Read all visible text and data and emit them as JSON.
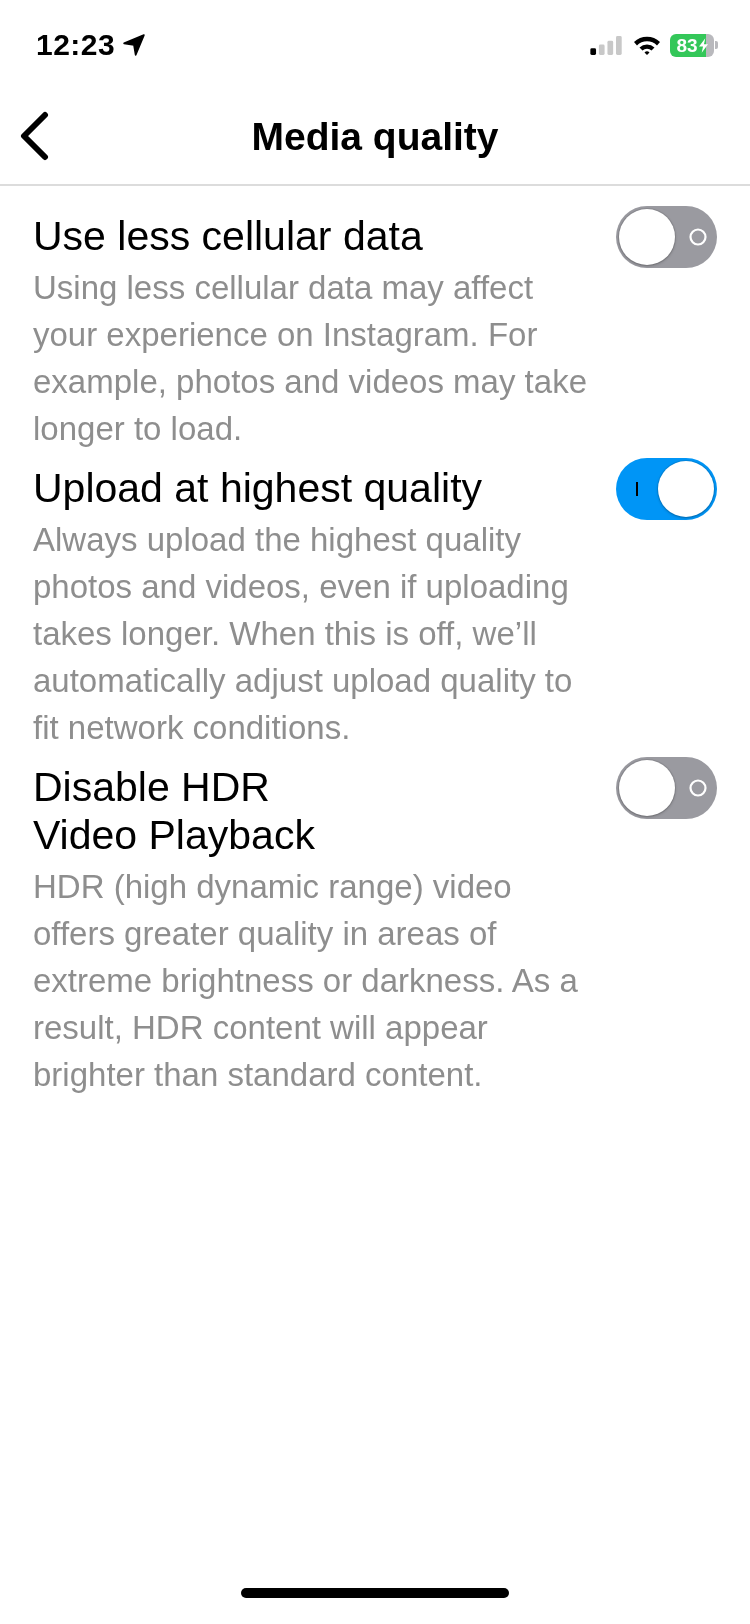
{
  "status_bar": {
    "time": "12:23",
    "battery": "83"
  },
  "nav": {
    "title": "Media quality"
  },
  "settings": [
    {
      "title": "Use less cellular data",
      "description": "Using less cellular data may affect your experience on Instagram. For example, photos and videos may take longer to load.",
      "on": false
    },
    {
      "title": "Upload at highest quality",
      "description": "Always upload the highest quality photos and videos, even if uploading takes longer. When this is off, we’ll automatically adjust upload quality to fit network conditions.",
      "on": true
    },
    {
      "title": "Disable HDR\nVideo Playback",
      "description": "HDR (high dynamic range) video offers greater quality in areas of extreme brightness or darkness. As a result, HDR content will appear brighter than standard content.",
      "on": false
    }
  ]
}
